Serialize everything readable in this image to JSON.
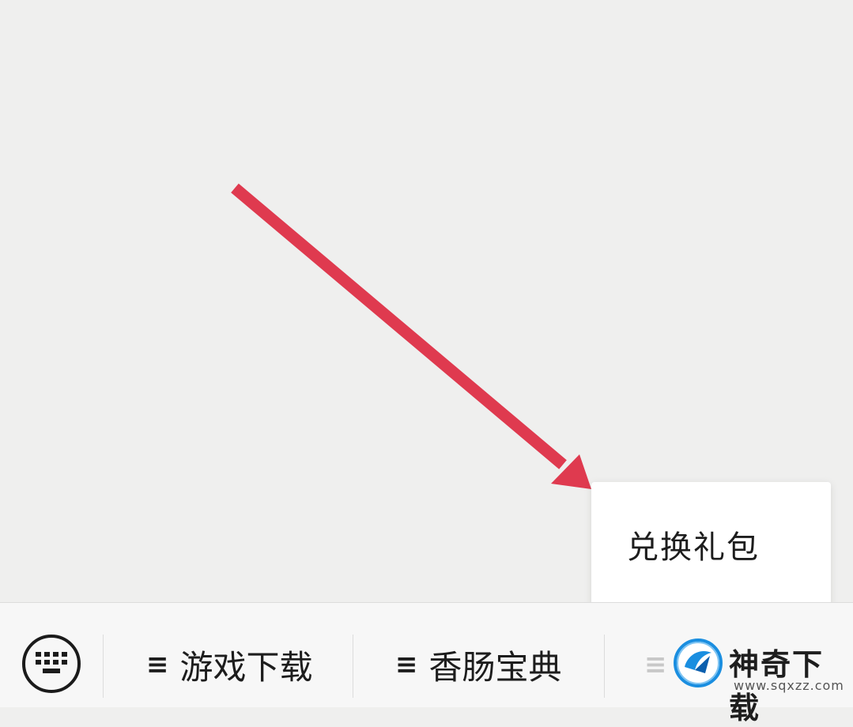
{
  "popup_menu": {
    "items": [
      {
        "label": "兑换礼包"
      }
    ]
  },
  "menu_bar": {
    "keyboard_icon": "keyboard-icon",
    "tabs": [
      {
        "icon": "≡",
        "label": "游戏下载"
      },
      {
        "icon": "≡",
        "label": "香肠宝典"
      },
      {
        "icon": "≡",
        "label": ""
      }
    ]
  },
  "watermark": {
    "name": "神奇下载",
    "url": "www.sqxzz.com"
  },
  "colors": {
    "arrow": "#df3a4f",
    "background": "#efefee",
    "menu_bar": "#f7f7f7",
    "popup": "#ffffff",
    "text": "#1d1d1d",
    "logo_blue": "#1a8ee0"
  }
}
